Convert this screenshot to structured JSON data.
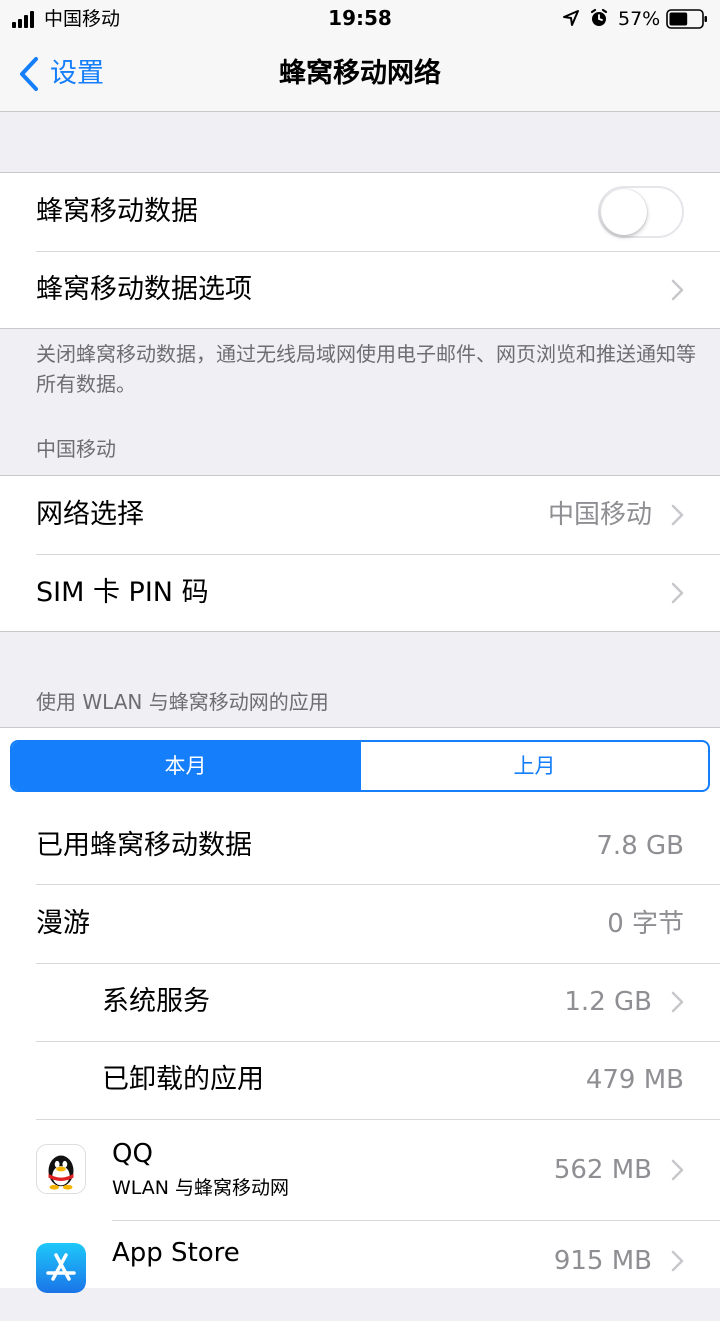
{
  "status_bar": {
    "carrier": "中国移动",
    "time": "19:58",
    "battery": "57%",
    "battery_level": 57
  },
  "nav": {
    "back_label": "设置",
    "title": "蜂窝移动网络"
  },
  "cellular": {
    "data_label": "蜂窝移动数据",
    "data_enabled": false,
    "options_label": "蜂窝移动数据选项",
    "footnote": "关闭蜂窝移动数据，通过无线局域网使用电子邮件、网页浏览和推送通知等所有数据。"
  },
  "carrier_section": {
    "header": "中国移动",
    "network_label": "网络选择",
    "network_value": "中国移动",
    "sim_label": "SIM 卡 PIN 码"
  },
  "usage": {
    "header": "使用 WLAN 与蜂窝移动网的应用",
    "segments": [
      "本月",
      "上月"
    ],
    "selected_segment": "本月",
    "rows": [
      {
        "label": "已用蜂窝移动数据",
        "value": "7.8 GB"
      },
      {
        "label": "漫游",
        "value": "0 字节"
      },
      {
        "label": "系统服务",
        "value": "1.2 GB"
      },
      {
        "label": "已卸载的应用",
        "value": "479 MB"
      }
    ],
    "apps": [
      {
        "name": "QQ",
        "subtitle": "WLAN 与蜂窝移动网",
        "value": "562 MB",
        "icon": "qq-penguin-icon"
      },
      {
        "name": "App Store",
        "value": "915 MB",
        "icon": "app-store-icon"
      }
    ]
  },
  "colors": {
    "accent": "#157efb",
    "background": "#efeff4",
    "secondary_text": "#8e8e93"
  }
}
